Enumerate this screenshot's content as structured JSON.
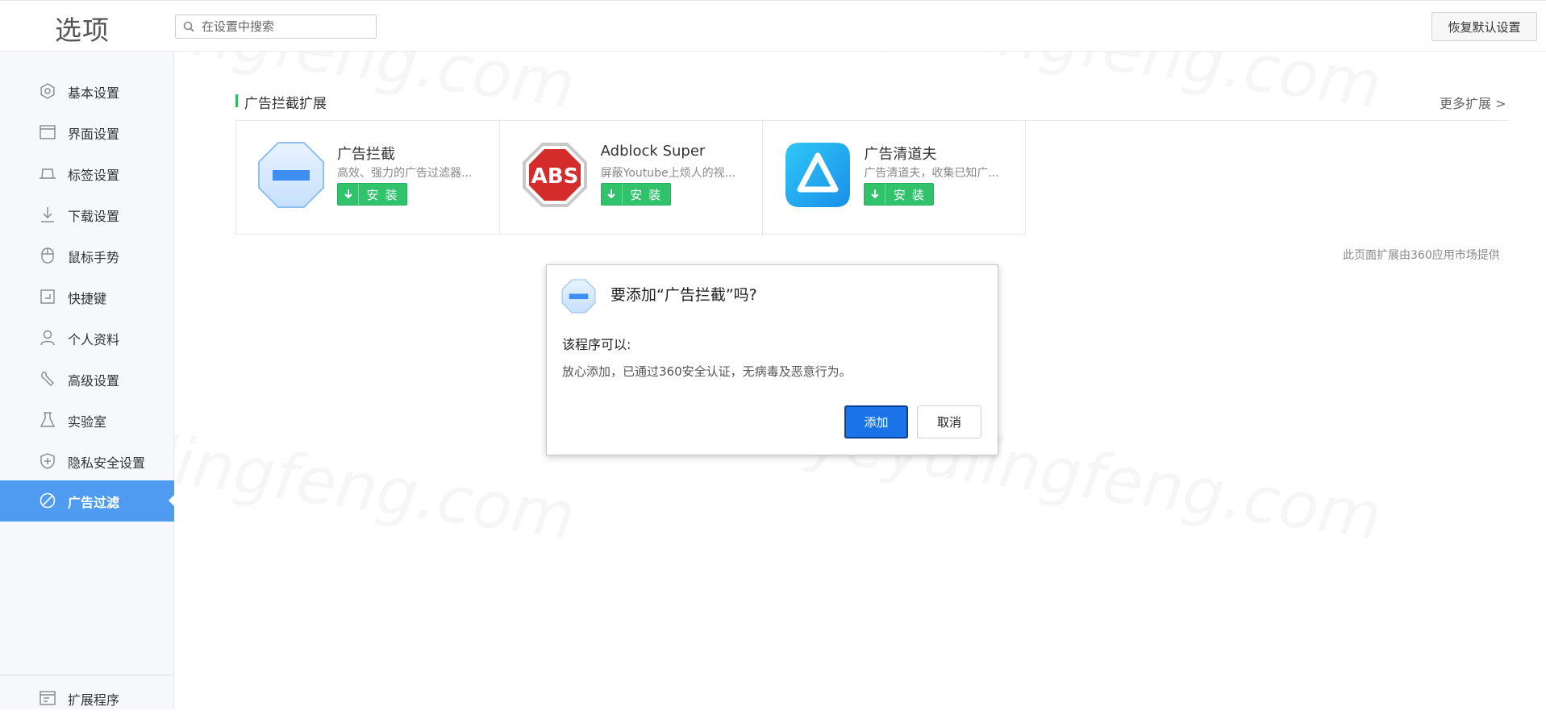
{
  "header": {
    "title": "选项",
    "search_placeholder": "在设置中搜索",
    "reset_label": "恢复默认设置"
  },
  "sidebar": {
    "items": [
      {
        "label": "基本设置",
        "icon": "gear-icon"
      },
      {
        "label": "界面设置",
        "icon": "window-icon"
      },
      {
        "label": "标签设置",
        "icon": "tab-icon"
      },
      {
        "label": "下载设置",
        "icon": "download-icon"
      },
      {
        "label": "鼠标手势",
        "icon": "mouse-icon"
      },
      {
        "label": "快捷键",
        "icon": "shortcut-icon"
      },
      {
        "label": "个人资料",
        "icon": "user-icon"
      },
      {
        "label": "高级设置",
        "icon": "wrench-icon"
      },
      {
        "label": "实验室",
        "icon": "flask-icon"
      },
      {
        "label": "隐私安全设置",
        "icon": "shield-icon"
      },
      {
        "label": "广告过滤",
        "icon": "ban-icon",
        "active": true
      }
    ],
    "bottom_item": {
      "label": "扩展程序",
      "icon": "extension-icon"
    }
  },
  "main": {
    "section_title": "广告拦截扩展",
    "more_link": "更多扩展 >",
    "extensions": [
      {
        "name": "广告拦截",
        "desc": "高效、强力的广告过滤器...",
        "install_label": "安装",
        "icon": "octagon-minus-icon"
      },
      {
        "name": "Adblock Super",
        "desc": "屏蔽Youtube上烦人的视...",
        "install_label": "安装",
        "icon": "abs-stop-icon"
      },
      {
        "name": "广告清道夫",
        "desc": "广告清道夫，收集已知广...",
        "install_label": "安装",
        "icon": "triangle-logo-icon"
      }
    ],
    "provider_note": "此页面扩展由360应用市场提供"
  },
  "dialog": {
    "title": "要添加“广告拦截”吗?",
    "subtitle": "该程序可以:",
    "message": "放心添加，已通过360安全认证，无病毒及恶意行为。",
    "add_label": "添加",
    "cancel_label": "取消"
  },
  "watermark": "yeyulingfeng.com",
  "colors": {
    "accent": "#4f9bf1",
    "install_green": "#31c36c",
    "dialog_button": "#1a73e8",
    "section_marker": "#30bd68"
  }
}
